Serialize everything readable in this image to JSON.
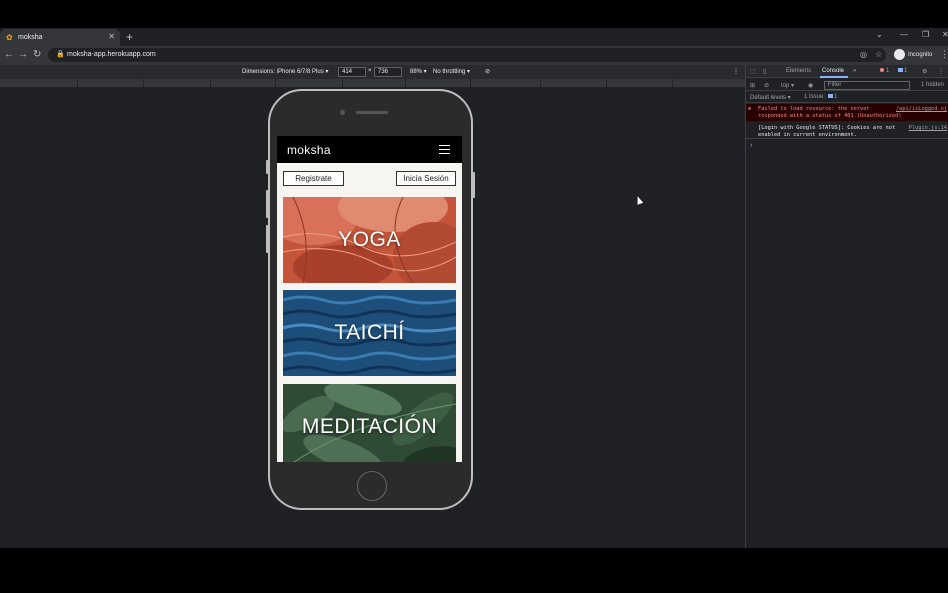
{
  "browser": {
    "tab_title": "moksha",
    "url": "moksha-app.herokuapp.com",
    "profile_label": "Incognito"
  },
  "device_toolbar": {
    "device": "Dimensions: iPhone 6/7/8 Plus ▾",
    "width": "414",
    "height": "736",
    "zoom": "88% ▾",
    "throttling": "No throttling ▾"
  },
  "app": {
    "brand": "moksha",
    "register_button": "Registrate",
    "login_button": "Inicia Sesión",
    "cards": [
      {
        "label": "YOGA",
        "color": "#c4553a"
      },
      {
        "label": "TAICHÍ",
        "color": "#1d4e7a"
      },
      {
        "label": "MEDITACIÓN",
        "color": "#2f4a35"
      }
    ]
  },
  "devtools": {
    "tabs": [
      "Elements",
      "Console",
      "»"
    ],
    "error_count": "1",
    "info_count": "1",
    "context": "top ▾",
    "filter_placeholder": "Filter",
    "hidden": "1 hidden",
    "levels": "Default levels ▾",
    "issues": "1 Issue:",
    "issues_count": "1",
    "error_line1": "Failed to load resource: the server",
    "error_line2": "responded with a status of 401 (Unauthorized)",
    "error_source": "/api/isLogged.nj",
    "info_line1": "[Login with Google STATUS]: Cookies are not",
    "info_line2": "enabled in current environment.",
    "info_source": "Plugin.js:14",
    "prompt": "›"
  }
}
